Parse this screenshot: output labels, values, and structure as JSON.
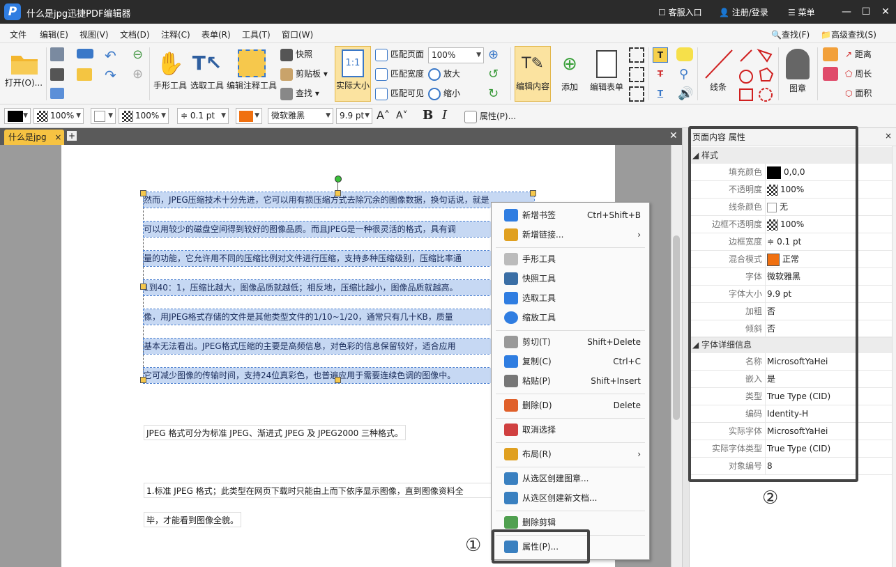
{
  "app": {
    "logo": "P",
    "title": "什么是jpg迅捷PDF编辑器",
    "service": "客服入口",
    "register": "注册/登录",
    "menu_label": "菜单",
    "min": "—",
    "max": "☐",
    "close": "✕"
  },
  "menubar": [
    "文件",
    "编辑(E)",
    "视图(V)",
    "文档(D)",
    "注释(C)",
    "表单(R)",
    "工具(T)",
    "窗口(W)"
  ],
  "menubar_right": {
    "find": "查找(F)",
    "adv_find": "高级查找(S)"
  },
  "ribbon": {
    "open": "打开(O)...",
    "hand": "手形工具",
    "select": "选取工具",
    "edit_annot": "编辑注释工具",
    "snapshot": "快照",
    "clipboard": "剪贴板",
    "find": "查找",
    "actual": "实际大小",
    "actual_icon": "1:1",
    "fit_page": "匹配页面",
    "fit_width": "匹配宽度",
    "fit_visible": "匹配可见",
    "zoom": "100%",
    "zoom_in": "放大",
    "zoom_out": "缩小",
    "edit_content": "编辑内容",
    "add": "添加",
    "edit_form": "编辑表单",
    "line": "线条",
    "stamp": "图章",
    "distance": "距离",
    "perimeter": "周长",
    "area": "面积"
  },
  "fmt": {
    "stroke_opacity": "100%",
    "fill_opacity": "100%",
    "width": "0.1 pt",
    "font": "微软雅黑",
    "size": "9.9 pt",
    "props": "属性(P)..."
  },
  "doc": {
    "tab": "什么是jpg",
    "sel_lines": [
      "然而，JPEG压缩技术十分先进，它可以用有损压缩方式去除冗余的图像数据，换句话说，就是",
      "可以用较少的磁盘空间得到较好的图像品质。而且JPEG是一种很灵活的格式，具有调",
      "量的功能，它允许用不同的压缩比例对文件进行压缩，支持多种压缩级别，压缩比率通",
      "1到40：1，压缩比越大，图像品质就越低；相反地，压缩比越小，图像品质就越高。",
      "像，用JPEG格式存储的文件是其他类型文件的1/10~1/20，通常只有几十KB，质量",
      "基本无法看出。JPEG格式压缩的主要是高频信息，对色彩的信息保留较好，适合应用",
      "它可减少图像的传输时间，支持24位真彩色，也普遍应用于需要连续色调的图像中。"
    ],
    "line2": "JPEG 格式可分为标准 JPEG、渐进式 JPEG 及 JPEG2000 三种格式。",
    "line3a": "1.标准 JPEG 格式；此类型在网页下载时只能由上而下依序显示图像，直到图像资料全",
    "line3b": "毕，才能看到图像全貌。"
  },
  "context_menu": [
    {
      "label": "新增书签",
      "shortcut": "Ctrl+Shift+B",
      "color": "#2f7de1"
    },
    {
      "label": "新增链接...",
      "shortcut": "›",
      "color": "#e0a020"
    },
    {
      "label": "手形工具",
      "shortcut": "",
      "color": "#999"
    },
    {
      "label": "快照工具",
      "shortcut": "",
      "color": "#3a6ea5"
    },
    {
      "label": "选取工具",
      "shortcut": "",
      "color": "#2f7de1"
    },
    {
      "label": "缩放工具",
      "shortcut": "",
      "color": "#2f7de1"
    },
    {
      "label": "剪切(T)",
      "shortcut": "Shift+Delete",
      "color": "#888"
    },
    {
      "label": "复制(C)",
      "shortcut": "Ctrl+C",
      "color": "#2f7de1"
    },
    {
      "label": "粘贴(P)",
      "shortcut": "Shift+Insert",
      "color": "#777"
    },
    {
      "label": "删除(D)",
      "shortcut": "Delete",
      "color": "#e0602a"
    },
    {
      "label": "取消选择",
      "shortcut": "",
      "color": "#d04040"
    },
    {
      "label": "布局(R)",
      "shortcut": "›",
      "color": "#e0a020"
    },
    {
      "label": "从选区创建图章...",
      "shortcut": "",
      "color": "#3a80c0"
    },
    {
      "label": "从选区创建新文档...",
      "shortcut": "",
      "color": "#3a80c0"
    },
    {
      "label": "删除剪辑",
      "shortcut": "",
      "color": "#50a050"
    },
    {
      "label": "属性(P)...",
      "shortcut": "",
      "color": "#3a80c0"
    }
  ],
  "panel": {
    "title": "页面内容 属性",
    "style_section": "样式",
    "font_section": "字体详细信息",
    "style": [
      [
        "填充颜色",
        "0,0,0"
      ],
      [
        "不透明度",
        "100%"
      ],
      [
        "线条颜色",
        "无"
      ],
      [
        "边框不透明度",
        "100%"
      ],
      [
        "边框宽度",
        "0.1 pt"
      ],
      [
        "混合模式",
        "正常"
      ],
      [
        "字体",
        "微软雅黑"
      ],
      [
        "字体大小",
        "9.9 pt"
      ],
      [
        "加粗",
        "否"
      ],
      [
        "倾斜",
        "否"
      ]
    ],
    "font": [
      [
        "名称",
        "MicrosoftYaHei"
      ],
      [
        "嵌入",
        "是"
      ],
      [
        "类型",
        "True Type (CID)"
      ],
      [
        "编码",
        "Identity-H"
      ],
      [
        "实际字体",
        "MicrosoftYaHei"
      ],
      [
        "实际字体类型",
        "True Type (CID)"
      ],
      [
        "对象编号",
        "8"
      ]
    ]
  },
  "annotations": {
    "one": "①",
    "two": "②"
  }
}
